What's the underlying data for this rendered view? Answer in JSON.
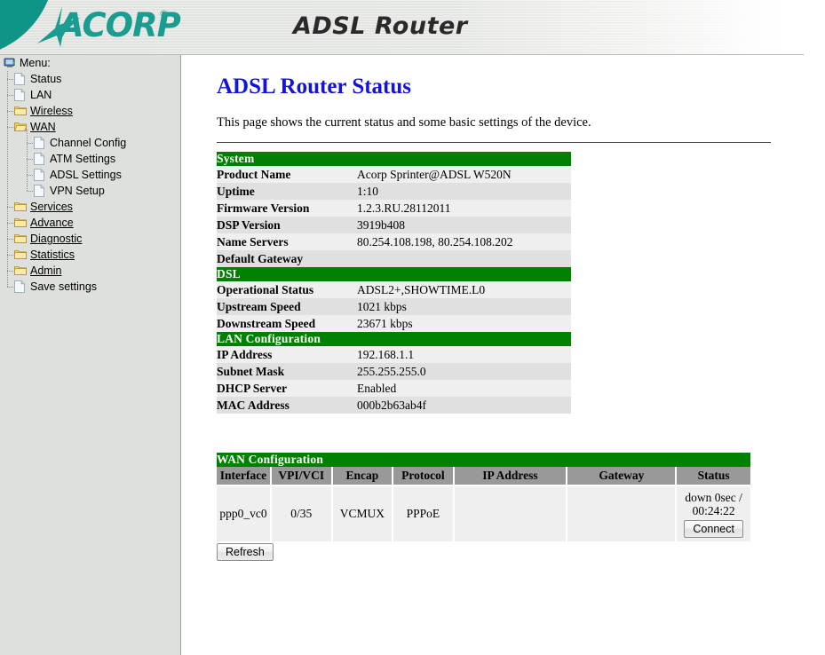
{
  "banner": {
    "brand": "ACORP",
    "brand_reg": "®",
    "title": "ADSL Router"
  },
  "sidebar": {
    "root_label": "Menu:",
    "root_icon": "computer-icon",
    "items": [
      {
        "label": "Status",
        "icon": "page-icon",
        "level": 1,
        "link": false
      },
      {
        "label": "LAN",
        "icon": "page-icon",
        "level": 1,
        "link": false
      },
      {
        "label": "Wireless",
        "icon": "folder-icon",
        "level": 1,
        "link": true
      },
      {
        "label": "WAN",
        "icon": "folder-open-icon",
        "level": 1,
        "link": true
      },
      {
        "label": "Channel Config",
        "icon": "page-icon",
        "level": 2,
        "link": false
      },
      {
        "label": "ATM Settings",
        "icon": "page-icon",
        "level": 2,
        "link": false
      },
      {
        "label": "ADSL Settings",
        "icon": "page-icon",
        "level": 2,
        "link": false
      },
      {
        "label": "VPN Setup",
        "icon": "page-icon",
        "level": 2,
        "link": false
      },
      {
        "label": "Services",
        "icon": "folder-icon",
        "level": 1,
        "link": true
      },
      {
        "label": "Advance",
        "icon": "folder-icon",
        "level": 1,
        "link": true
      },
      {
        "label": "Diagnostic",
        "icon": "folder-icon",
        "level": 1,
        "link": true
      },
      {
        "label": "Statistics",
        "icon": "folder-icon",
        "level": 1,
        "link": true
      },
      {
        "label": "Admin",
        "icon": "folder-icon",
        "level": 1,
        "link": true
      },
      {
        "label": "Save settings",
        "icon": "page-icon",
        "level": 1,
        "link": false
      }
    ]
  },
  "main": {
    "title": "ADSL Router Status",
    "description": "This page shows the current status and some basic settings of the device.",
    "sections": [
      {
        "heading": "System",
        "rows": [
          {
            "key": "Product Name",
            "value": "Acorp Sprinter@ADSL W520N"
          },
          {
            "key": "Uptime",
            "value": "1:10"
          },
          {
            "key": "Firmware Version",
            "value": "1.2.3.RU.28112011"
          },
          {
            "key": "DSP Version",
            "value": "3919b408"
          },
          {
            "key": "Name Servers",
            "value": "80.254.108.198, 80.254.108.202"
          },
          {
            "key": "Default Gateway",
            "value": ""
          }
        ]
      },
      {
        "heading": "DSL",
        "rows": [
          {
            "key": "Operational Status",
            "value": "ADSL2+,SHOWTIME.L0"
          },
          {
            "key": "Upstream Speed",
            "value": "1021 kbps"
          },
          {
            "key": "Downstream Speed",
            "value": "23671 kbps"
          }
        ]
      },
      {
        "heading": "LAN Configuration",
        "rows": [
          {
            "key": "IP Address",
            "value": "192.168.1.1"
          },
          {
            "key": "Subnet Mask",
            "value": "255.255.255.0"
          },
          {
            "key": "DHCP Server",
            "value": "Enabled"
          },
          {
            "key": "MAC Address",
            "value": "000b2b63ab4f"
          }
        ]
      }
    ],
    "wan": {
      "heading": "WAN Configuration",
      "columns": [
        "Interface",
        "VPI/VCI",
        "Encap",
        "Protocol",
        "IP Address",
        "Gateway",
        "Status"
      ],
      "rows": [
        {
          "interface": "ppp0_vc0",
          "vpi_vci": "0/35",
          "encap": "VCMUX",
          "protocol": "PPPoE",
          "ip_address": "",
          "gateway": "",
          "status_line1": "down 0sec /",
          "status_line2": "00:24:22",
          "connect_label": "Connect"
        }
      ]
    },
    "refresh_label": "Refresh"
  },
  "colors": {
    "section_green": "#008000",
    "title_blue": "#1414d4",
    "logo_teal": "#1a9c90",
    "sidebar_bg": "#dde0dc",
    "colhead_gray": "#999999"
  }
}
